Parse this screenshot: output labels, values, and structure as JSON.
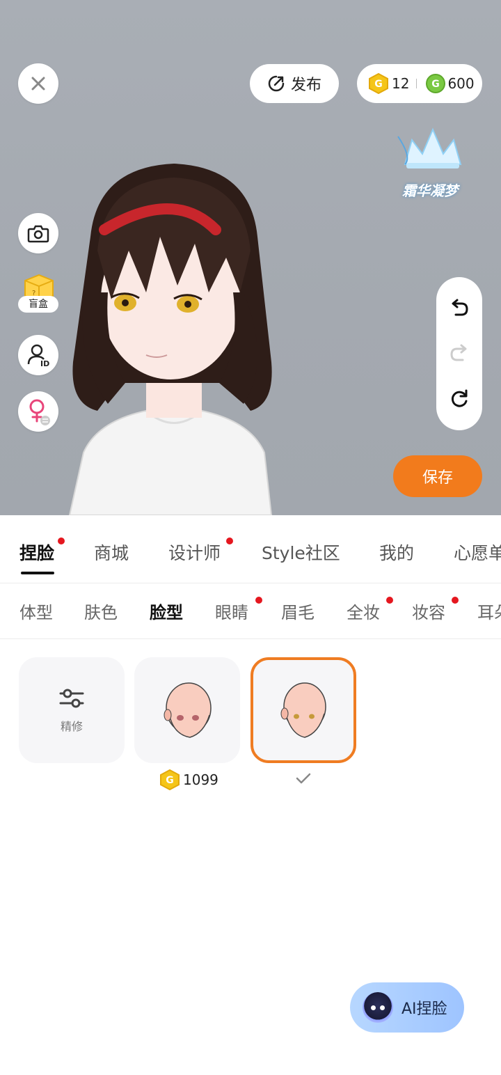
{
  "header": {
    "publish_label": "发布",
    "gold_coins": "12",
    "green_coins": "600",
    "badge_text": "霜华凝梦"
  },
  "side": {
    "blind_box_label": "盲盒"
  },
  "actions": {
    "save_label": "保存",
    "ai_label": "AI捏脸"
  },
  "main_tabs": [
    {
      "label": "捏脸",
      "active": true,
      "dot": true
    },
    {
      "label": "商城",
      "active": false,
      "dot": false
    },
    {
      "label": "设计师",
      "active": false,
      "dot": true
    },
    {
      "label": "Style社区",
      "active": false,
      "dot": false
    },
    {
      "label": "我的",
      "active": false,
      "dot": false
    },
    {
      "label": "心愿单",
      "active": false,
      "dot": false
    }
  ],
  "sub_tabs": [
    {
      "label": "体型",
      "active": false,
      "dot": false
    },
    {
      "label": "肤色",
      "active": false,
      "dot": false
    },
    {
      "label": "脸型",
      "active": true,
      "dot": false
    },
    {
      "label": "眼睛",
      "active": false,
      "dot": true
    },
    {
      "label": "眉毛",
      "active": false,
      "dot": false
    },
    {
      "label": "全妆",
      "active": false,
      "dot": true
    },
    {
      "label": "妆容",
      "active": false,
      "dot": true
    },
    {
      "label": "耳朵",
      "active": false,
      "dot": false
    }
  ],
  "items": {
    "refine_label": "精修",
    "face1_price": "1099"
  },
  "colors": {
    "accent": "#f27b1c",
    "selected_border": "#ef7c22",
    "red_dot": "#e5171f",
    "gold_coin": "#f5c518",
    "green_coin": "#7ac943"
  }
}
